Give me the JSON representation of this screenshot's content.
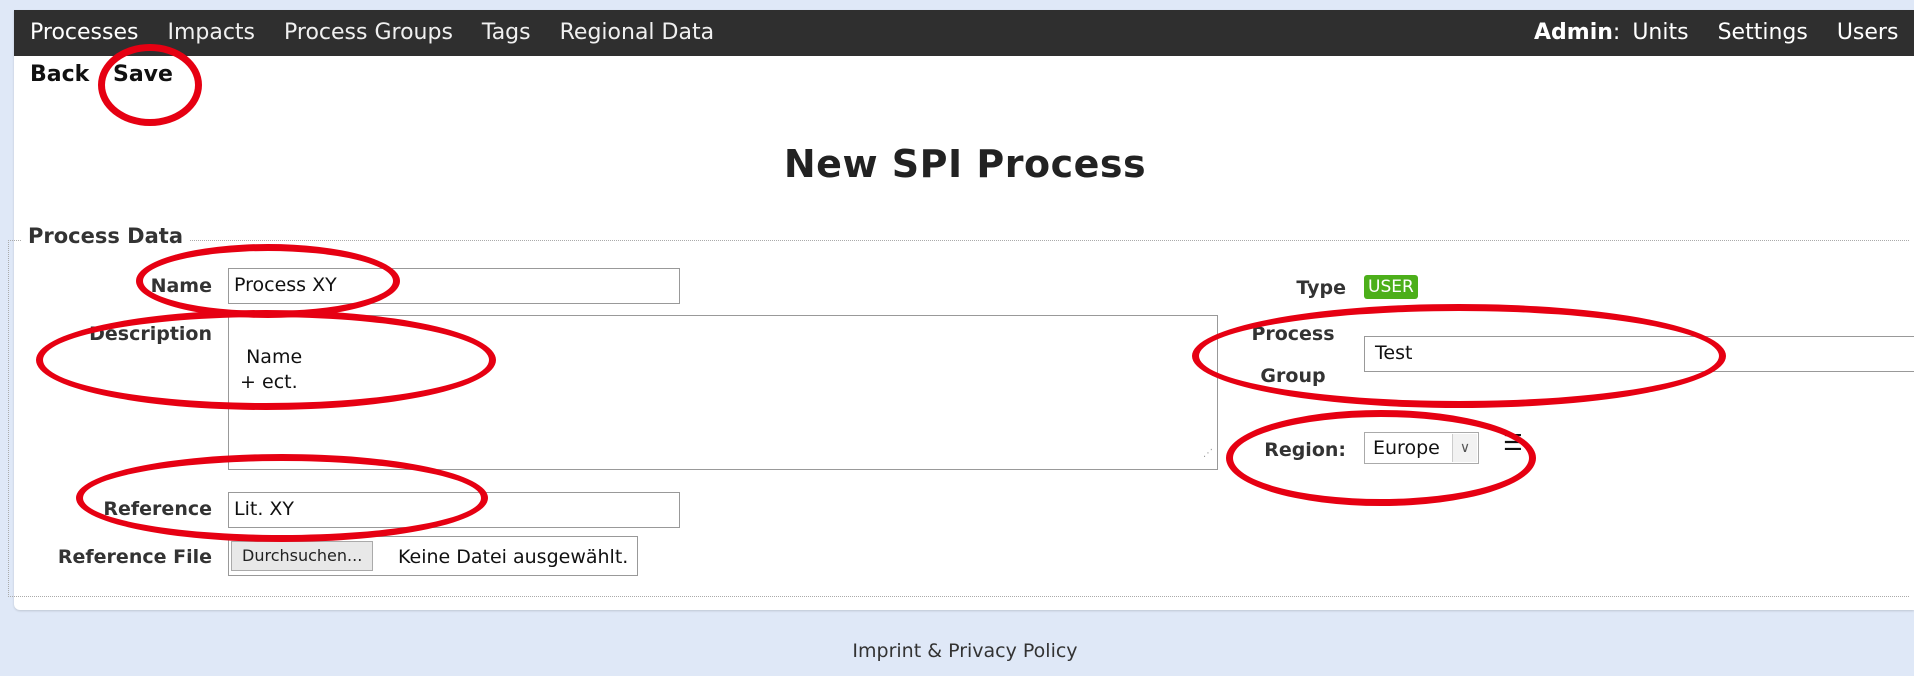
{
  "nav": {
    "items": [
      {
        "label": "Processes",
        "active": true
      },
      {
        "label": "Impacts"
      },
      {
        "label": "Process Groups"
      },
      {
        "label": "Tags"
      },
      {
        "label": "Regional Data"
      }
    ],
    "admin_label": "Admin",
    "admin_colon": ":",
    "admin_items": [
      "Units",
      "Settings",
      "Users"
    ]
  },
  "actions": {
    "back": "Back",
    "save": "Save"
  },
  "page_title": "New SPI Process",
  "form": {
    "legend": "Process Data",
    "name": {
      "label": "Name",
      "value": "Process XY"
    },
    "description": {
      "label": "Description",
      "value": "Name\n + ect."
    },
    "reference": {
      "label": "Reference",
      "value": "Lit. XY"
    },
    "reference_file": {
      "label": "Reference File",
      "button": "Durchsuchen...",
      "status": "Keine Datei ausgewählt."
    },
    "type": {
      "label": "Type",
      "badge": "USER"
    },
    "process_group": {
      "label_line1": "Process",
      "label_line2": "Group",
      "value": "Test"
    },
    "region": {
      "label": "Region:",
      "value": "Europe"
    }
  },
  "footer": "Imprint & Privacy Policy",
  "colors": {
    "navbar": "#2f2f2f",
    "badge": "#4caf1a",
    "annotation": "#e60012",
    "page_bg": "#dfe8f7"
  },
  "icons": [
    "chevron-down-icon",
    "list-icon",
    "resize-grip-icon"
  ]
}
